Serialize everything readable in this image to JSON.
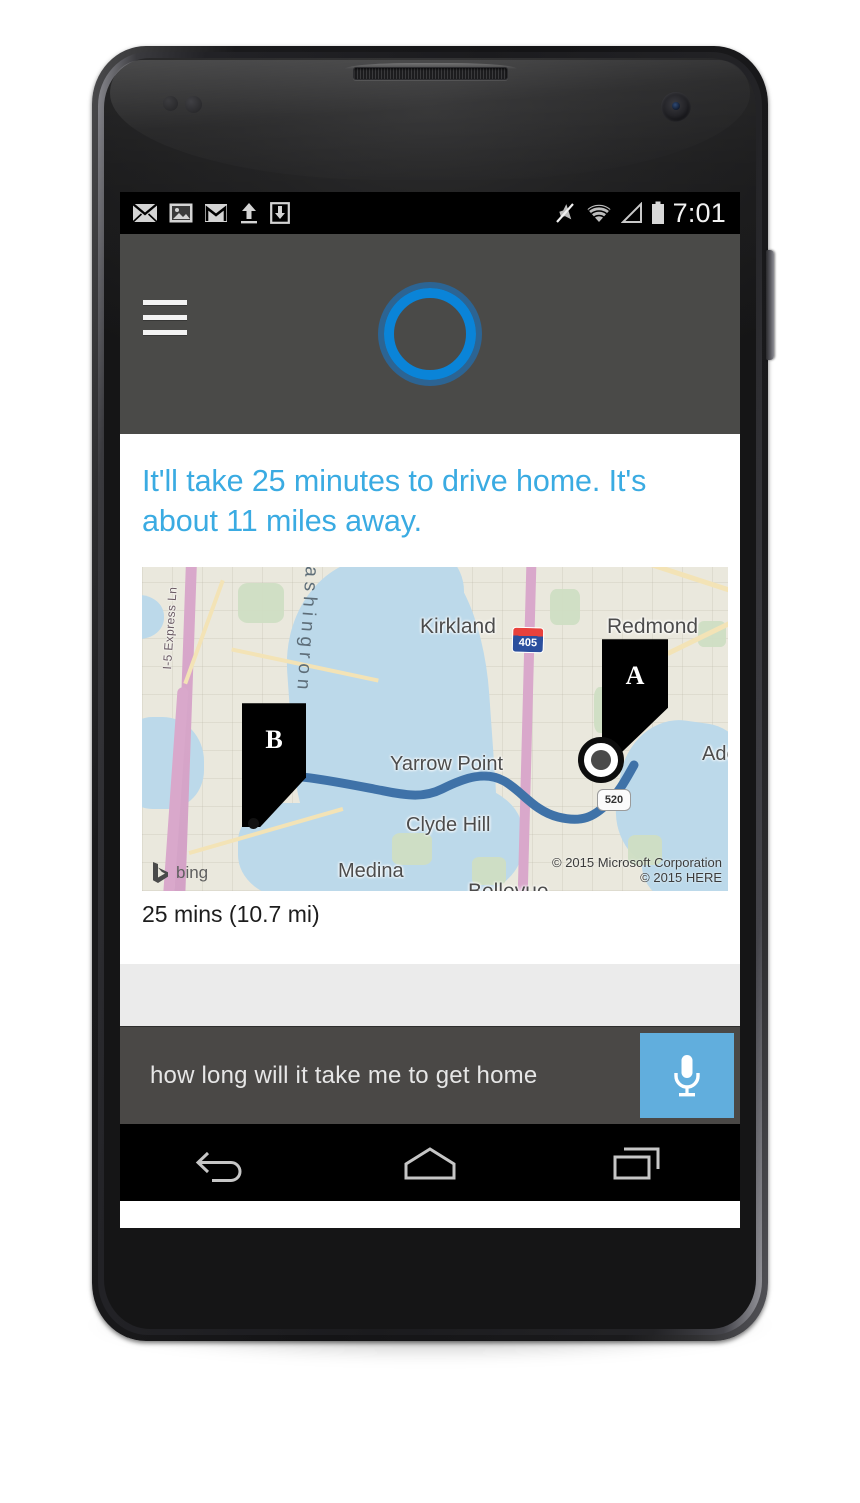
{
  "status_bar": {
    "time": "7:01",
    "left_icons": [
      "email-icon",
      "photo-icon",
      "gmail-icon",
      "upload-icon",
      "download-icon"
    ],
    "right_icons": [
      "mute-icon",
      "wifi-icon",
      "cell-signal-icon",
      "battery-icon"
    ]
  },
  "header": {
    "menu_icon": "hamburger-menu-icon",
    "assistant_icon": "cortana-ring-icon",
    "background_color": "#4a4a48",
    "ring_color": "#0a84d8",
    "ring_outer_color": "#2c6493"
  },
  "answer": {
    "text": "It'll take 25 minutes to drive home. It's about 11 miles away.",
    "color": "#3aabe2"
  },
  "map": {
    "labels": {
      "kirkland": "Kirkland",
      "redmond": "Redmond",
      "yarrow_point": "Yarrow Point",
      "clyde_hill": "Clyde Hill",
      "medina": "Medina",
      "bellevue": "Bellevue",
      "adelmann": "Ade",
      "washington": "ashingron",
      "express_lane": "I-5 Express Ln"
    },
    "shields": {
      "i405": "405",
      "sr520": "520"
    },
    "markers": {
      "a": "A",
      "b": "B"
    },
    "provider_logo": "bing",
    "credits": [
      "© 2015 Microsoft Corporation",
      "© 2015 HERE"
    ],
    "route_color": "#3f72a8"
  },
  "route_summary": {
    "text": "25 mins (10.7 mi)"
  },
  "input": {
    "query_text": "how long will it take me to get home",
    "mic_icon": "microphone-icon",
    "mic_color": "#61aedd"
  },
  "nav_bar": {
    "back": "back-icon",
    "home": "home-icon",
    "recents": "recent-apps-icon"
  }
}
